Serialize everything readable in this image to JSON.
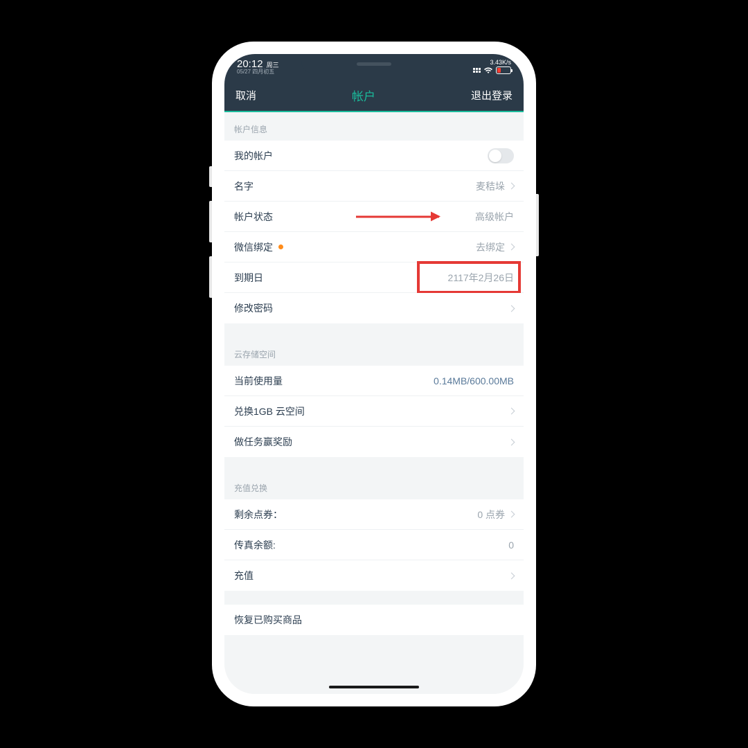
{
  "status": {
    "time": "20:12",
    "weekday": "周三",
    "date": "05/27 四月初五",
    "net_speed": "3.43K/s"
  },
  "nav": {
    "cancel": "取消",
    "title": "帐户",
    "logout": "退出登录"
  },
  "sections": {
    "account_info": {
      "header": "帐户信息",
      "my_account": "我的帐户",
      "name_label": "名字",
      "name_value": "麦秸垛",
      "status_label": "帐户状态",
      "status_value": "高级帐户",
      "wechat_label": "微信绑定",
      "wechat_value": "去绑定",
      "expiry_label": "到期日",
      "expiry_value": "2117年2月26日",
      "change_pw": "修改密码"
    },
    "cloud": {
      "header": "云存储空间",
      "usage_label": "当前使用量",
      "usage_value": "0.14MB/600.00MB",
      "redeem_1gb": "兑换1GB 云空间",
      "tasks": "做任务赢奖励"
    },
    "recharge": {
      "header": "充值兑换",
      "points_label": "剩余点券：",
      "points_value": "0 点券",
      "fax_label": "传真余额:",
      "fax_value": "0",
      "recharge": "充值"
    },
    "restore": {
      "label": "恢复已购买商品"
    }
  }
}
